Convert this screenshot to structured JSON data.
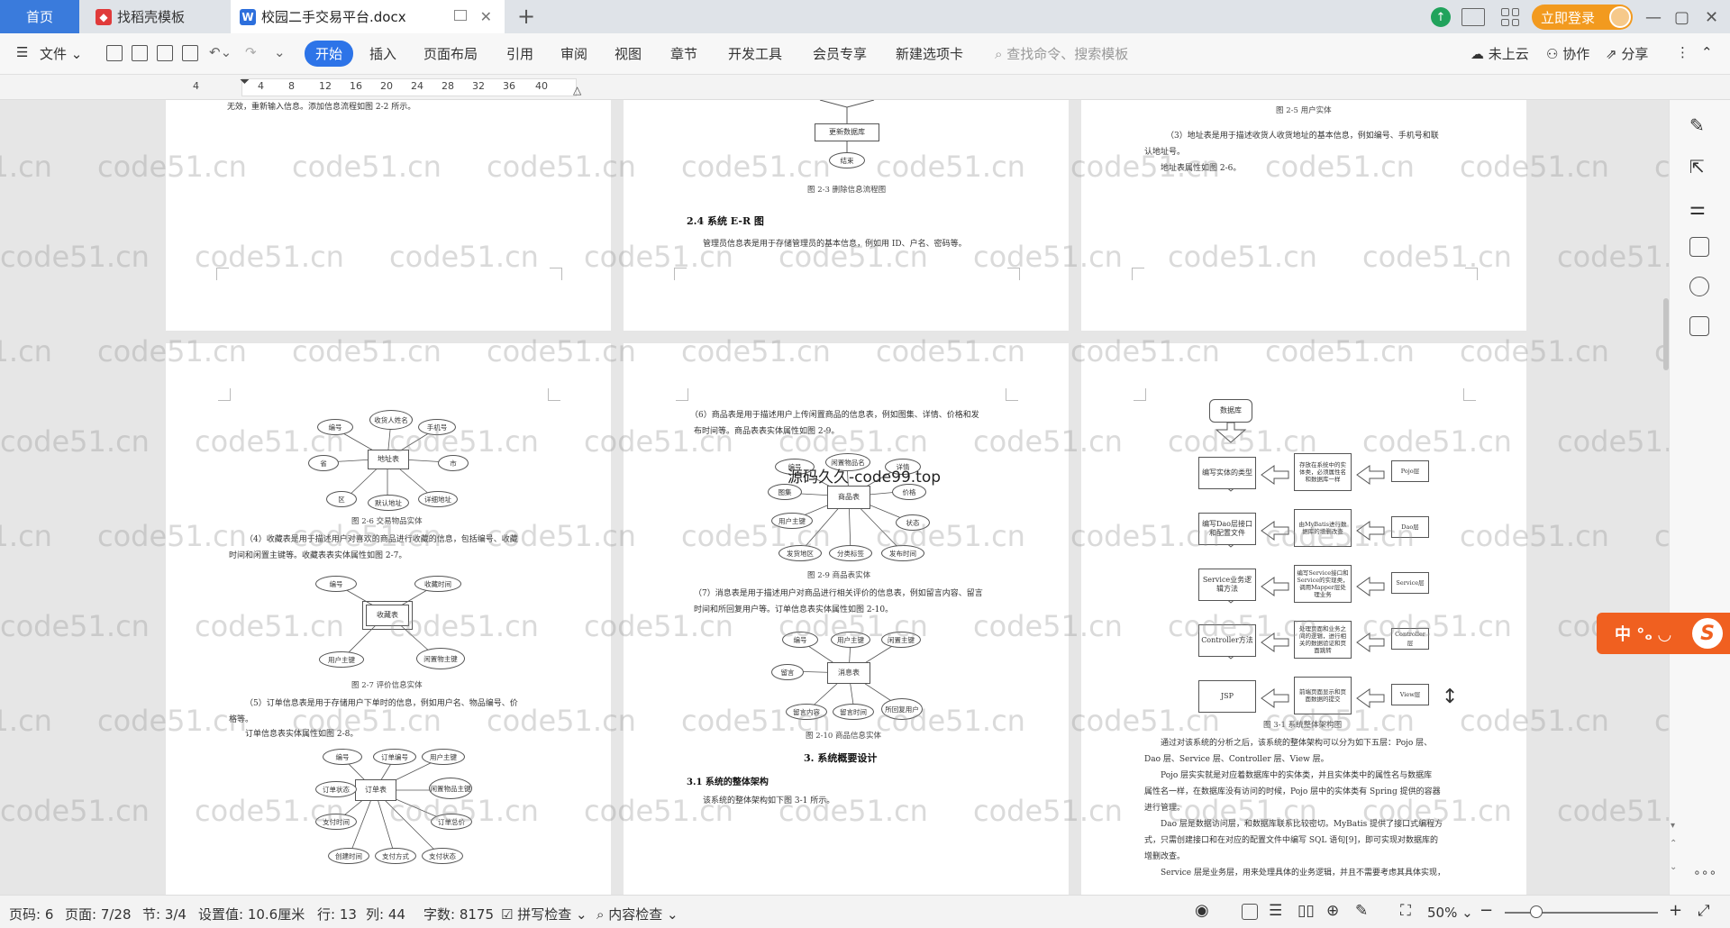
{
  "tabs": {
    "home": "首页",
    "template": "找稻壳模板",
    "document": "校园二手交易平台.docx"
  },
  "titlebar": {
    "login": "立即登录"
  },
  "menu": {
    "file": "文件",
    "items": [
      "开始",
      "插入",
      "页面布局",
      "引用",
      "审阅",
      "视图",
      "章节",
      "开发工具",
      "会员专享",
      "新建选项卡"
    ],
    "search_placeholder": "查找命令、搜索模板",
    "cloud": "未上云",
    "collab": "协作",
    "share": "分享"
  },
  "ruler": {
    "ticks": [
      "4",
      "4",
      "8",
      "12",
      "16",
      "20",
      "24",
      "28",
      "32",
      "36",
      "40"
    ]
  },
  "pages": {
    "p1": {
      "text1": "无效，重新输入信息。添加信息流程如图 2-2 所示。"
    },
    "p2": {
      "db_box": "更新数据库",
      "end": "结束",
      "cap": "图 2-3 删除信息流程图",
      "heading": "2.4  系统 E-R 图",
      "para": "管理员信息表是用于存储管理员的基本信息，例如用 ID、户名、密码等。"
    },
    "p3": {
      "cap": "图 2-5 用户实体",
      "para1": "（3）地址表是用于描述收货人收货地址的基本信息，例如编号、手机号和联",
      "para2": "认地址号。",
      "para3": "地址表属性如图 2-6。"
    },
    "p4": {
      "er1": {
        "center": "地址表",
        "attrs": [
          "编号",
          "收货人姓名",
          "手机号",
          "省",
          "市",
          "区",
          "默认地址",
          "详细地址"
        ]
      },
      "cap1": "图 2-6 交易物品实体",
      "para1": "（4）收藏表是用于描述用户对喜欢的商品进行收藏的信息，包括编号、收藏",
      "para2": "时间和闲置主键等。收藏表表实体属性如图 2-7。",
      "er2": {
        "center": "收藏表",
        "attrs": [
          "编号",
          "收藏时间",
          "用户主键",
          "闲置物主键"
        ]
      },
      "cap2": "图 2-7 评价信息实体",
      "para3": "（5）订单信息表是用于存储用户下单时的信息，例如用户名、物品编号、价",
      "para4": "格等。",
      "para5": "订单信息表实体属性如图 2-8。",
      "er3": {
        "center": "订单表",
        "attrs": [
          "编号",
          "订单编号",
          "用户主键",
          "订单状态",
          "闲置物品主键",
          "支付时间",
          "订单总价",
          "创建时间",
          "支付方式",
          "支付状态"
        ]
      }
    },
    "p5": {
      "para1": "（6）商品表是用于描述用户上传闲置商品的信息表，例如图集、详情、价格和发",
      "para2": "布时间等。商品表表实体属性如图 2-9。",
      "er1": {
        "center": "商品表",
        "attrs": [
          "编号",
          "闲置物品名",
          "详情",
          "图集",
          "价格",
          "用户主键",
          "状态",
          "发货地区",
          "分类标签",
          "发布时间"
        ]
      },
      "cap1": "图 2-9 商品表实体",
      "para3": "（7）消息表是用于描述用户对商品进行相关评价的信息表，例如留言内容、留言",
      "para4": "时间和所回复用户等。订单信息表实体属性如图 2-10。",
      "er2": {
        "center": "消息表",
        "attrs": [
          "编号",
          "用户主键",
          "闲置主键",
          "留言",
          "留言内容",
          "留言时间",
          "所回复用户"
        ]
      },
      "cap2": "图 2-10 商品信息实体",
      "heading1": "3.  系统概要设计",
      "heading2": "3.1  系统的整体架构",
      "para5": "该系统的整体架构如下图 3-1 所示。"
    },
    "p6": {
      "db": "数据库",
      "left": [
        "编写实体的类型",
        "编写Dao层接口和配置文件",
        "Service业务逻辑方法",
        "Controller方法",
        "JSP"
      ],
      "mid": [
        "存放在系统中的实体类，必须属性名和数据库一样",
        "由MyBatis进行数据库的增删改查",
        "编写Service接口和Service的实现类，调用Mapper层处理业务",
        "处理页面和业务之间的逻辑，进行相关的数据验证和页面跳转",
        "前端页面显示和页面数据的提交"
      ],
      "right": [
        "Pojo层",
        "Dao层",
        "Service层",
        "Controller层",
        "View层"
      ],
      "cap": "图 3-1 系统整体架构图",
      "para1": "通过对该系统的分析之后，该系统的整体架构可以分为如下五层：Pojo 层、",
      "para2": "Dao 层、Service 层、Controller 层、View 层。",
      "para3": "Pojo 层实实就是对应着数据库中的实体类，并且实体类中的属性名与数据库",
      "para4": "属性名一样，在数据库没有访问的时候，Pojo 层中的实体类有 Spring 提供的容器",
      "para5": "进行管理。",
      "para6": "Dao 层是数据访问层，和数据库联系比较密切。MyBatis 提供了接口式编程方",
      "para7": "式，只需创建接口和在对应的配置文件中编写 SQL 语句[9]，即可实现对数据库的",
      "para8": "增删改查。",
      "para9": "Service 层是业务层，用来处理具体的业务逻辑，并且不需要考虑其具体实现，"
    }
  },
  "watermark": {
    "site": "code51.cn",
    "center": "源码久久-code99.top"
  },
  "floatTag": "中 °ₒ ◡",
  "status": {
    "page": "页码: 6",
    "pages": "页面: 7/28",
    "section": "节: 3/4",
    "setting": "设置值: 10.6厘米",
    "row": "行: 13",
    "col": "列: 44",
    "words": "字数: 8175",
    "spell": "拼写检查",
    "content": "内容检查",
    "zoom": "50%"
  }
}
